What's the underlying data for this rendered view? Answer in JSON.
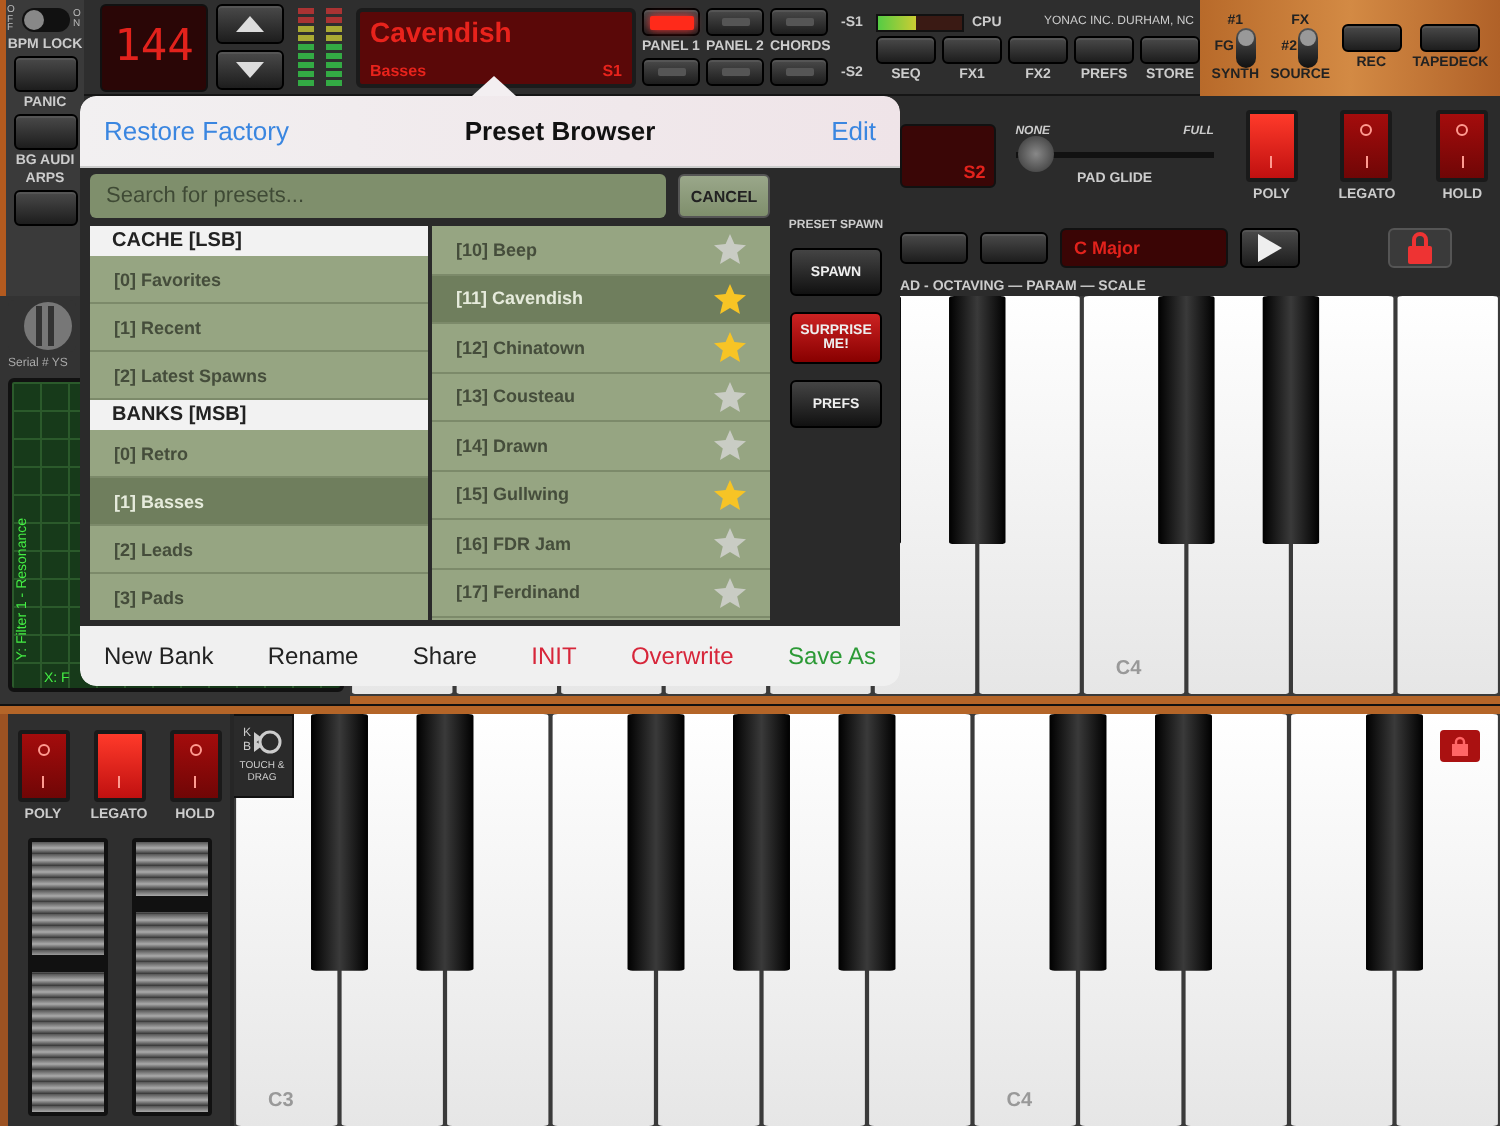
{
  "left_strip": {
    "bpm_lock": {
      "off_label": "OFF",
      "on_label": "ON",
      "label": "BPM LOCK",
      "on": false
    },
    "buttons": [
      {
        "label": "PANIC"
      },
      {
        "label": "BG AUDI"
      }
    ],
    "arps_label": "ARPS"
  },
  "header": {
    "tempo": "144",
    "preset_display": {
      "name": "Cavendish",
      "bank": "Basses",
      "slot": "S1"
    },
    "panel_buttons": [
      {
        "label": "PANEL 1",
        "lit": true
      },
      {
        "label": "PANEL 2",
        "lit": false
      },
      {
        "label": "CHORDS",
        "lit": false
      }
    ],
    "slot_labels": [
      "-S1",
      "-S2"
    ],
    "cpu": {
      "label": "CPU",
      "level": 0.45
    },
    "maker": "YONAC INC. DURHAM, NC",
    "function_buttons": [
      "SEQ",
      "FX1",
      "FX2",
      "PREFS",
      "STORE"
    ],
    "toggles": [
      {
        "label": "SYNTH",
        "side": "FG",
        "top": "#1",
        "up": true
      },
      {
        "label": "SOURCE",
        "side": "#2",
        "top": "FX",
        "up": true
      }
    ],
    "record_buttons": [
      "REC",
      "TAPEDECK"
    ]
  },
  "control_panel": {
    "slot_display": "S2",
    "glide": {
      "min": "NONE",
      "max": "FULL",
      "label": "PAD GLIDE",
      "level": 0.05
    },
    "switches": [
      {
        "label": "POLY",
        "on": true
      },
      {
        "label": "LEGATO",
        "on": false
      },
      {
        "label": "HOLD",
        "on": false
      }
    ],
    "scale_display": "C Major",
    "row_caption": "AD - OCTAVING — PARAM — SCALE"
  },
  "xy_pad": {
    "serial": "Serial # YS",
    "y_label": "Y: Filter 1 - Resonance",
    "x_label": "X: F"
  },
  "upper_keyboard": {
    "labels": [
      "C4"
    ]
  },
  "lower_panel": {
    "switches": [
      {
        "label": "POLY",
        "on": false
      },
      {
        "label": "LEGATO",
        "on": true
      },
      {
        "label": "HOLD",
        "on": false
      }
    ],
    "badge": {
      "letters": [
        "K",
        "B"
      ],
      "caption": "TOUCH & DRAG"
    }
  },
  "lower_keyboard": {
    "labels": [
      "C3",
      "C4"
    ]
  },
  "preset_browser": {
    "restore": "Restore Factory",
    "title": "Preset Browser",
    "edit": "Edit",
    "search_placeholder": "Search for presets...",
    "cancel": "CANCEL",
    "sections": [
      {
        "header": "CACHE [LSB]",
        "items": [
          {
            "label": "[0] Favorites",
            "selected": false
          },
          {
            "label": "[1] Recent",
            "selected": false
          },
          {
            "label": "[2] Latest Spawns",
            "selected": false
          }
        ]
      },
      {
        "header": "BANKS [MSB]",
        "items": [
          {
            "label": "[0] Retro",
            "selected": false
          },
          {
            "label": "[1] Basses",
            "selected": true
          },
          {
            "label": "[2] Leads",
            "selected": false
          },
          {
            "label": "[3] Pads",
            "selected": false
          }
        ]
      }
    ],
    "presets": [
      {
        "label": "[10] Beep",
        "favorite": false,
        "selected": false
      },
      {
        "label": "[11] Cavendish",
        "favorite": true,
        "selected": true
      },
      {
        "label": "[12] Chinatown",
        "favorite": true,
        "selected": false
      },
      {
        "label": "[13] Cousteau",
        "favorite": false,
        "selected": false
      },
      {
        "label": "[14] Drawn",
        "favorite": false,
        "selected": false
      },
      {
        "label": "[15] Gullwing",
        "favorite": true,
        "selected": false
      },
      {
        "label": "[16] FDR Jam",
        "favorite": false,
        "selected": false
      },
      {
        "label": "[17] Ferdinand",
        "favorite": false,
        "selected": false
      }
    ],
    "spawn": {
      "title": "PRESET SPAWN",
      "buttons": [
        {
          "label": "SPAWN",
          "kind": "normal"
        },
        {
          "label": "SURPRISE ME!",
          "kind": "alert"
        },
        {
          "label": "PREFS",
          "kind": "normal"
        }
      ]
    },
    "actions": [
      {
        "label": "New Bank",
        "kind": "plain"
      },
      {
        "label": "Rename",
        "kind": "plain"
      },
      {
        "label": "Share",
        "kind": "plain"
      },
      {
        "label": "INIT",
        "kind": "danger"
      },
      {
        "label": "Overwrite",
        "kind": "danger"
      },
      {
        "label": "Save As",
        "kind": "confirm"
      }
    ]
  }
}
